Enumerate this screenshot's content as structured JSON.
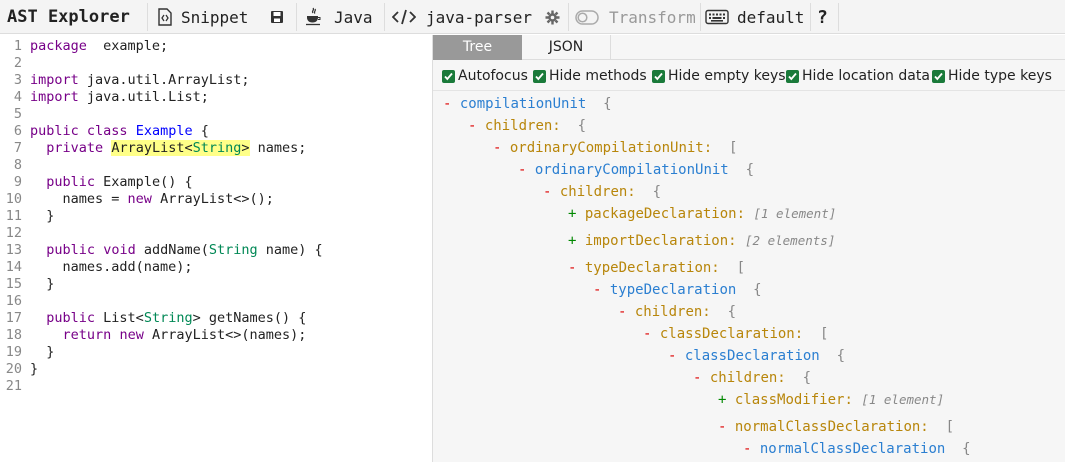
{
  "toolbar": {
    "title": "AST Explorer",
    "snippet_label": "Snippet",
    "language_label": "Java",
    "parser_label": "java-parser",
    "transform_label": "Transform",
    "keymap_label": "default",
    "help_label": "?"
  },
  "editor": {
    "lines": [
      {
        "n": "1",
        "parts": [
          [
            "kw",
            "package"
          ],
          [
            "",
            "  example;"
          ]
        ]
      },
      {
        "n": "2",
        "parts": []
      },
      {
        "n": "3",
        "parts": [
          [
            "kw",
            "import"
          ],
          [
            "",
            " java.util.ArrayList;"
          ]
        ]
      },
      {
        "n": "4",
        "parts": [
          [
            "kw",
            "import"
          ],
          [
            "",
            " java.util.List;"
          ]
        ]
      },
      {
        "n": "5",
        "parts": []
      },
      {
        "n": "6",
        "parts": [
          [
            "kw",
            "public"
          ],
          [
            "",
            " "
          ],
          [
            "kw",
            "class"
          ],
          [
            "",
            " "
          ],
          [
            "def",
            "Example"
          ],
          [
            "",
            " {"
          ]
        ]
      },
      {
        "n": "7",
        "parts": [
          [
            "",
            "  "
          ],
          [
            "kw",
            "private"
          ],
          [
            "",
            " "
          ],
          [
            "hl",
            "ArrayList<"
          ],
          [
            "hltyp",
            "String"
          ],
          [
            "hl",
            ">"
          ],
          [
            "",
            " names;"
          ]
        ]
      },
      {
        "n": "8",
        "parts": []
      },
      {
        "n": "9",
        "parts": [
          [
            "",
            "  "
          ],
          [
            "kw",
            "public"
          ],
          [
            "",
            " Example() {"
          ]
        ]
      },
      {
        "n": "10",
        "parts": [
          [
            "",
            "    names = "
          ],
          [
            "kw",
            "new"
          ],
          [
            "",
            " ArrayList<>();"
          ]
        ]
      },
      {
        "n": "11",
        "parts": [
          [
            "",
            "  }"
          ]
        ]
      },
      {
        "n": "12",
        "parts": []
      },
      {
        "n": "13",
        "parts": [
          [
            "",
            "  "
          ],
          [
            "kw",
            "public"
          ],
          [
            "",
            " "
          ],
          [
            "kw",
            "void"
          ],
          [
            "",
            " addName("
          ],
          [
            "typ",
            "String"
          ],
          [
            "",
            " name) {"
          ]
        ]
      },
      {
        "n": "14",
        "parts": [
          [
            "",
            "    names.add(name);"
          ]
        ]
      },
      {
        "n": "15",
        "parts": [
          [
            "",
            "  }"
          ]
        ]
      },
      {
        "n": "16",
        "parts": []
      },
      {
        "n": "17",
        "parts": [
          [
            "",
            "  "
          ],
          [
            "kw",
            "public"
          ],
          [
            "",
            " List<"
          ],
          [
            "typ",
            "String"
          ],
          [
            "",
            "> getNames() {"
          ]
        ]
      },
      {
        "n": "18",
        "parts": [
          [
            "",
            "    "
          ],
          [
            "kw",
            "return"
          ],
          [
            "",
            " "
          ],
          [
            "kw",
            "new"
          ],
          [
            "",
            " ArrayList<>(names);"
          ]
        ]
      },
      {
        "n": "19",
        "parts": [
          [
            "",
            "  }"
          ]
        ]
      },
      {
        "n": "20",
        "parts": [
          [
            "",
            "}"
          ]
        ]
      },
      {
        "n": "21",
        "parts": []
      }
    ]
  },
  "panel": {
    "tabs": [
      "Tree",
      "JSON"
    ],
    "options": [
      "Autofocus",
      "Hide methods",
      "Hide empty keys",
      "Hide location data",
      "Hide type keys"
    ],
    "tree": [
      {
        "toggle": "-",
        "kind": "type",
        "label": "compilationUnit",
        "bracket": "{",
        "summary": ""
      },
      {
        "toggle": "-",
        "kind": "key",
        "label": "children:",
        "bracket": "{",
        "summary": ""
      },
      {
        "toggle": "-",
        "kind": "key",
        "label": "ordinaryCompilationUnit:",
        "bracket": "[",
        "summary": ""
      },
      {
        "toggle": "-",
        "kind": "type",
        "label": "ordinaryCompilationUnit",
        "bracket": "{",
        "summary": ""
      },
      {
        "toggle": "-",
        "kind": "key",
        "label": "children:",
        "bracket": "{",
        "summary": ""
      },
      {
        "toggle": "+",
        "kind": "key",
        "label": "packageDeclaration:",
        "bracket": "",
        "summary": "[1 element]"
      },
      {
        "toggle": "+",
        "kind": "key",
        "label": "importDeclaration:",
        "bracket": "",
        "summary": "[2 elements]"
      },
      {
        "toggle": "-",
        "kind": "key",
        "label": "typeDeclaration:",
        "bracket": "[",
        "summary": ""
      },
      {
        "toggle": "-",
        "kind": "type",
        "label": "typeDeclaration",
        "bracket": "{",
        "summary": ""
      },
      {
        "toggle": "-",
        "kind": "key",
        "label": "children:",
        "bracket": "{",
        "summary": ""
      },
      {
        "toggle": "-",
        "kind": "key",
        "label": "classDeclaration:",
        "bracket": "[",
        "summary": ""
      },
      {
        "toggle": "-",
        "kind": "type",
        "label": "classDeclaration",
        "bracket": "{",
        "summary": ""
      },
      {
        "toggle": "-",
        "kind": "key",
        "label": "children:",
        "bracket": "{",
        "summary": ""
      },
      {
        "toggle": "+",
        "kind": "key",
        "label": "classModifier:",
        "bracket": "",
        "summary": "[1 element]"
      },
      {
        "toggle": "-",
        "kind": "key",
        "label": "normalClassDeclaration:",
        "bracket": "[",
        "summary": ""
      },
      {
        "toggle": "-",
        "kind": "type",
        "label": "normalClassDeclaration",
        "bracket": "{",
        "summary": ""
      }
    ]
  }
}
